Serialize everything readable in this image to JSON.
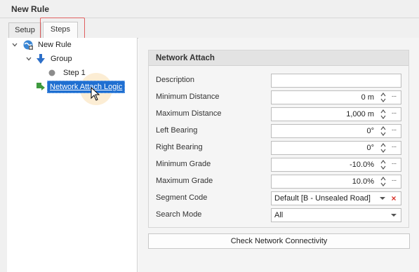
{
  "window": {
    "title": "New Rule"
  },
  "tabs": [
    {
      "label": "Setup",
      "selected": false
    },
    {
      "label": "Steps",
      "selected": true
    }
  ],
  "tree": {
    "root": {
      "label": "New Rule",
      "icon": "rule-globe-icon"
    },
    "group": {
      "label": "Group",
      "icon": "arrow-down-icon"
    },
    "step": {
      "label": "Step 1",
      "icon": "gray-circle-icon"
    },
    "selected": {
      "label": "Network Attach Logic",
      "icon": "green-arrow-icon"
    }
  },
  "panel": {
    "header": "Network Attach",
    "fields": [
      {
        "label": "Description",
        "value": "",
        "kind": "text"
      },
      {
        "label": "Minimum Distance",
        "value": "0 m",
        "kind": "spin"
      },
      {
        "label": "Maximum Distance",
        "value": "1,000 m",
        "kind": "spin"
      },
      {
        "label": "Left Bearing",
        "value": "0°",
        "kind": "spin"
      },
      {
        "label": "Right Bearing",
        "value": "0°",
        "kind": "spin"
      },
      {
        "label": "Minimum Grade",
        "value": "-10.0%",
        "kind": "spin"
      },
      {
        "label": "Maximum Grade",
        "value": "10.0%",
        "kind": "spin"
      },
      {
        "label": "Segment Code",
        "value": "Default [B - Unsealed Road]",
        "kind": "dropdown-clear"
      },
      {
        "label": "Search Mode",
        "value": "All",
        "kind": "dropdown"
      }
    ],
    "check_button": "Check Network Connectivity"
  },
  "ellipsis_label": "···",
  "clear_label": "×",
  "colors": {
    "selection": "#1f6fd1",
    "highlight_box": "#e06060",
    "clear_red": "#d9342b"
  }
}
